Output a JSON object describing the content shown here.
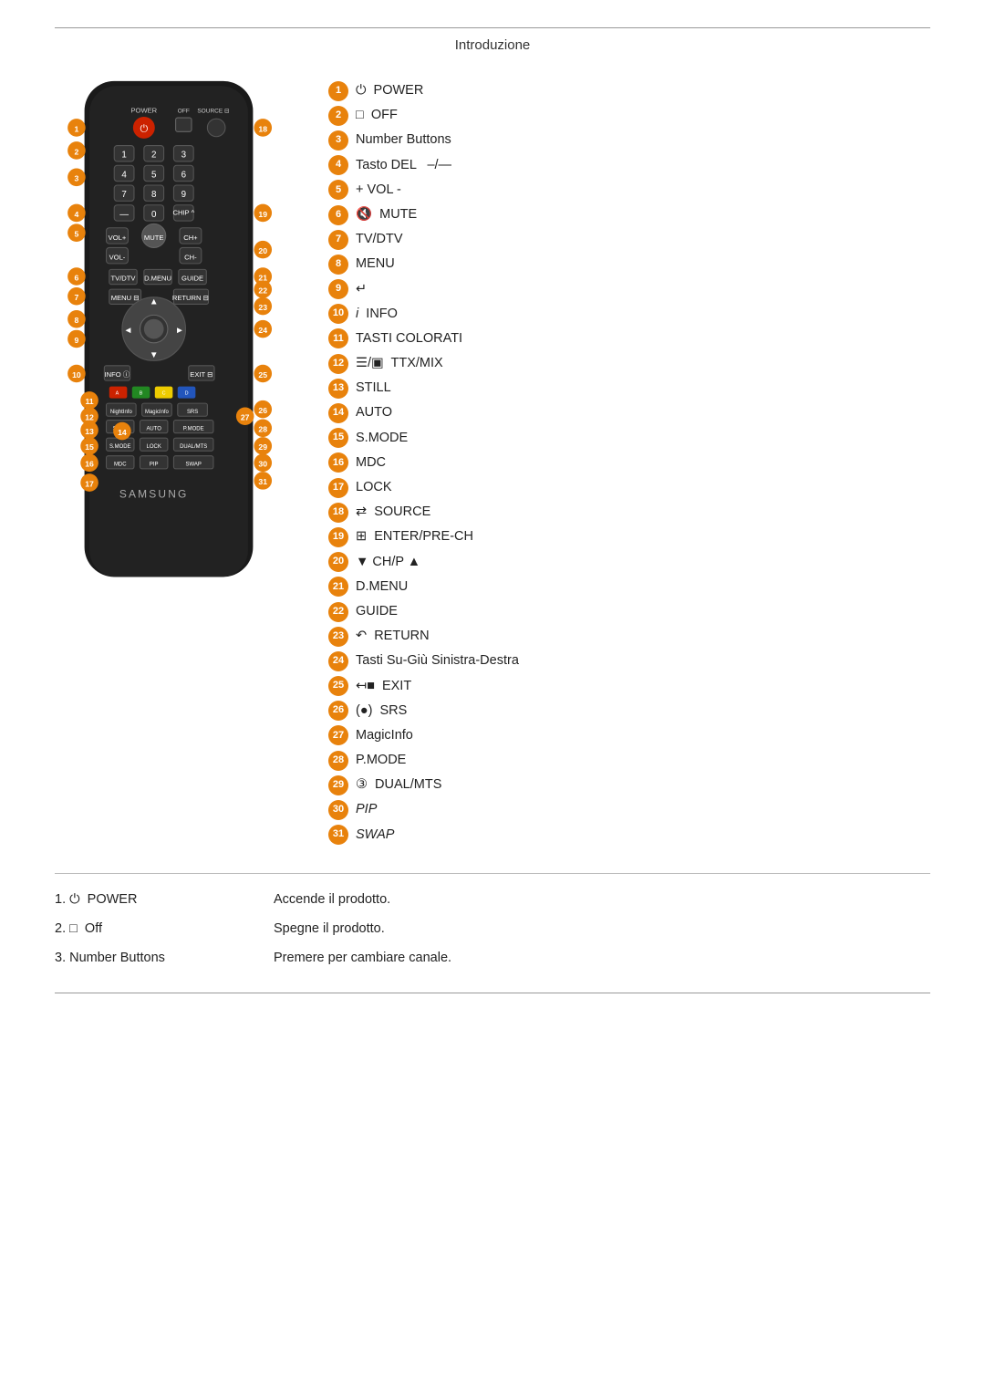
{
  "page": {
    "title": "Introduzione"
  },
  "legend": [
    {
      "num": 1,
      "text": "POWER",
      "icon": "power"
    },
    {
      "num": 2,
      "text": "OFF",
      "icon": "square"
    },
    {
      "num": 3,
      "text": "Number Buttons"
    },
    {
      "num": 4,
      "text": "Tasto DEL  —/—"
    },
    {
      "num": 5,
      "text": "+ VOL -"
    },
    {
      "num": 6,
      "text": "MUTE",
      "icon": "mute"
    },
    {
      "num": 7,
      "text": "TV/DTV"
    },
    {
      "num": 8,
      "text": "MENU"
    },
    {
      "num": 9,
      "text": "",
      "icon": "return-square"
    },
    {
      "num": 10,
      "text": "INFO",
      "icon": "info"
    },
    {
      "num": 11,
      "text": "TASTI COLORATI"
    },
    {
      "num": 12,
      "text": "TTX/MIX",
      "icon": "ttx"
    },
    {
      "num": 13,
      "text": "STILL"
    },
    {
      "num": 14,
      "text": "AUTO"
    },
    {
      "num": 15,
      "text": "S.MODE"
    },
    {
      "num": 16,
      "text": "MDC"
    },
    {
      "num": 17,
      "text": "LOCK"
    },
    {
      "num": 18,
      "text": "SOURCE",
      "icon": "source"
    },
    {
      "num": 19,
      "text": "ENTER/PRE-CH",
      "icon": "enter"
    },
    {
      "num": 20,
      "text": "▼ CH/P ▲"
    },
    {
      "num": 21,
      "text": "D.MENU"
    },
    {
      "num": 22,
      "text": "GUIDE"
    },
    {
      "num": 23,
      "text": "RETURN",
      "icon": "return"
    },
    {
      "num": 24,
      "text": "Tasti Su-Giù Sinistra-Destra"
    },
    {
      "num": 25,
      "text": "EXIT",
      "icon": "exit"
    },
    {
      "num": 26,
      "text": "SRS",
      "icon": "srs"
    },
    {
      "num": 27,
      "text": "MagicInfo"
    },
    {
      "num": 28,
      "text": "P.MODE"
    },
    {
      "num": 29,
      "text": "DUAL/MTS",
      "icon": "dual"
    },
    {
      "num": 30,
      "text": "PIP",
      "italic": true
    },
    {
      "num": 31,
      "text": "SWAP",
      "italic": true
    }
  ],
  "descriptions": [
    {
      "label": "1. ⏻  POWER",
      "text": "Accende il prodotto."
    },
    {
      "label": "2. □  Off",
      "text": "Spegne il prodotto."
    },
    {
      "label": "3. Number Buttons",
      "text": "Premere per cambiare canale."
    }
  ]
}
